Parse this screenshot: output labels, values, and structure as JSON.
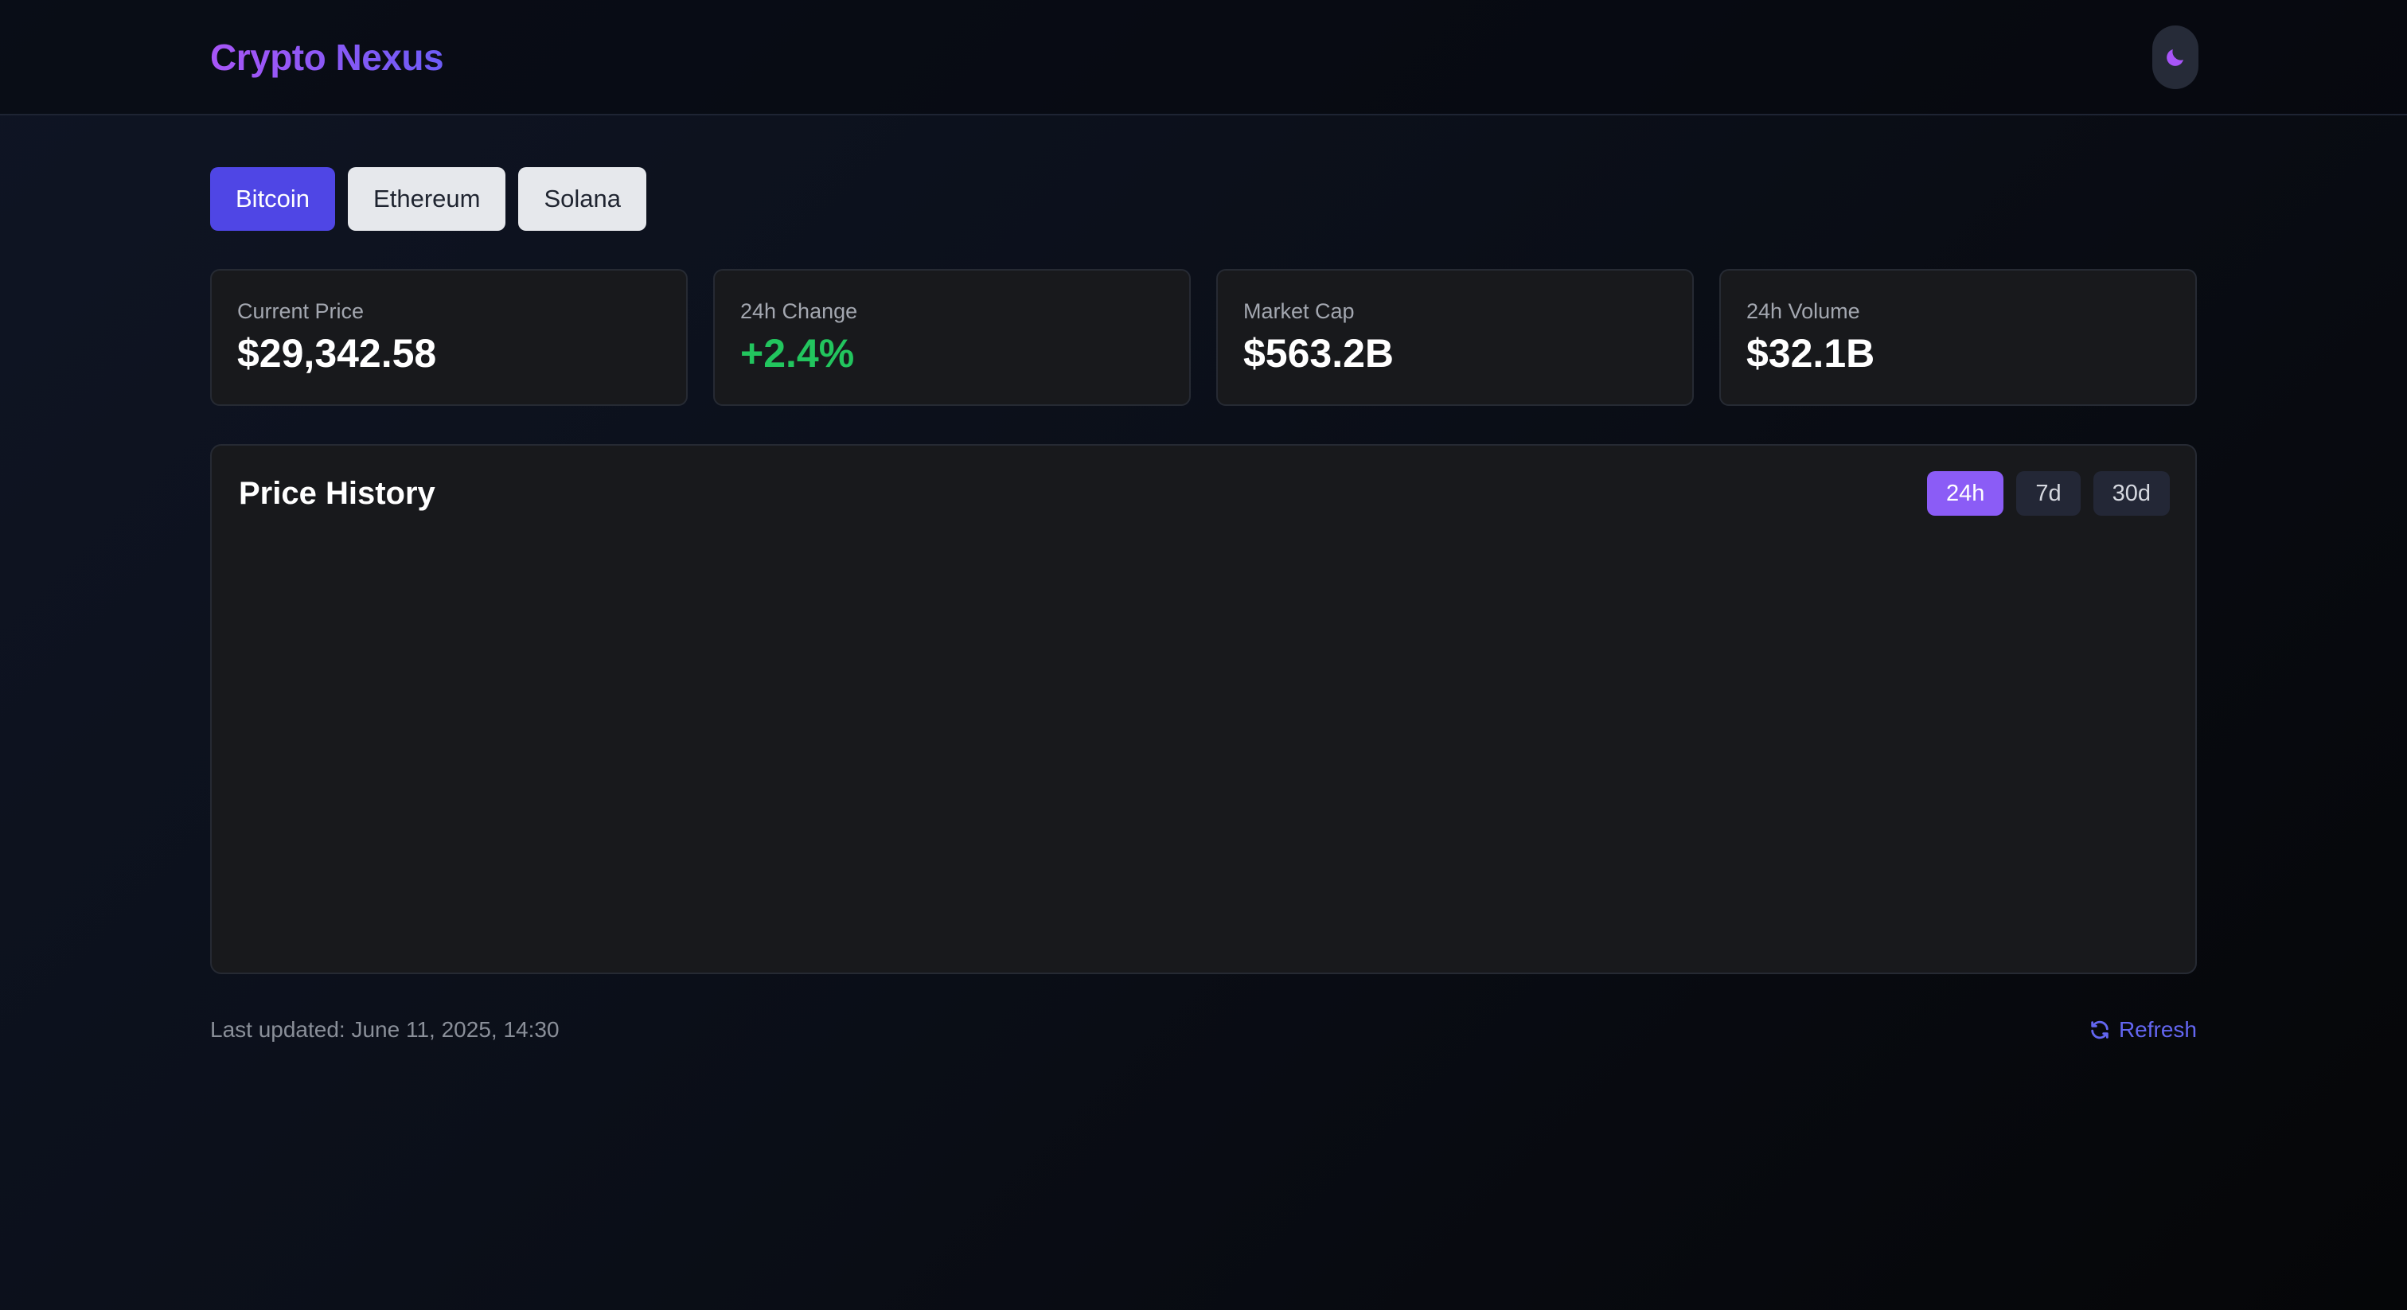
{
  "header": {
    "brand": "Crypto Nexus",
    "theme_icon": "moon-icon"
  },
  "coins": {
    "tabs": [
      {
        "label": "Bitcoin",
        "active": true
      },
      {
        "label": "Ethereum",
        "active": false
      },
      {
        "label": "Solana",
        "active": false
      }
    ]
  },
  "stats": [
    {
      "label": "Current Price",
      "value": "$29,342.58"
    },
    {
      "label": "24h Change",
      "value": "+2.4%"
    },
    {
      "label": "Market Cap",
      "value": "$563.2B"
    },
    {
      "label": "24h Volume",
      "value": "$32.1B"
    }
  ],
  "history": {
    "title": "Price History",
    "ranges": [
      {
        "label": "24h",
        "active": true
      },
      {
        "label": "7d",
        "active": false
      },
      {
        "label": "30d",
        "active": false
      }
    ]
  },
  "footer": {
    "last_updated": "Last updated: June 11, 2025, 14:30",
    "refresh_label": "Refresh",
    "refresh_icon": "refresh-icon"
  },
  "colors": {
    "accent": "#4f46e5",
    "accent_purple": "#8b5cf6",
    "positive": "#22c55e",
    "card_bg": "#18191c"
  }
}
